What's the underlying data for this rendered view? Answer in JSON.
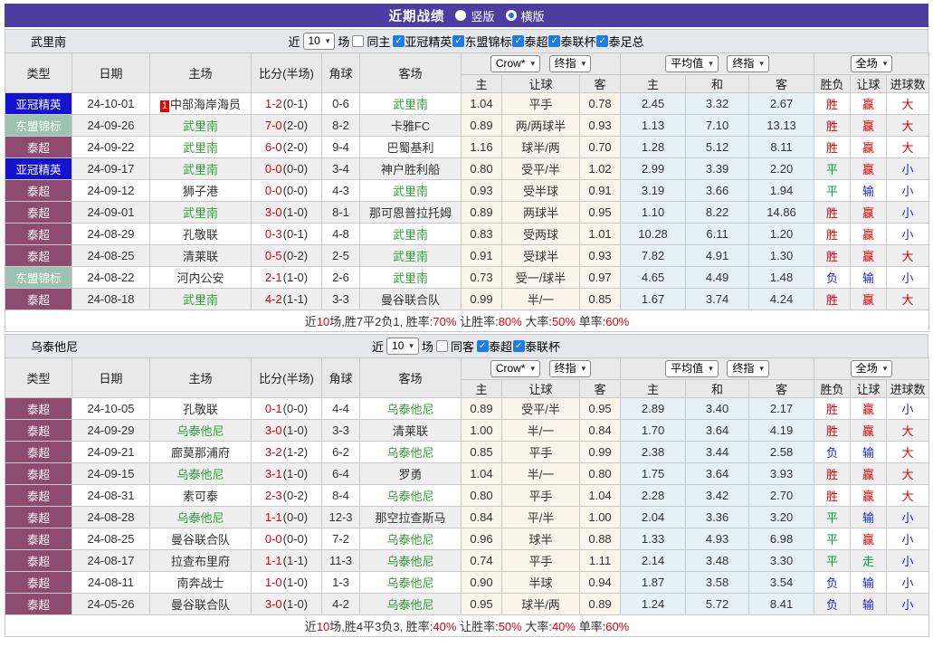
{
  "ui": {
    "title": "近期战绩",
    "radio_vertical": "竖版",
    "radio_horizontal": "横版",
    "recent_label": "近",
    "games_label": "场",
    "selects": {
      "crow": "Crow*",
      "final": "终指",
      "avg": "平均值",
      "full": "全场"
    }
  },
  "columns": {
    "type": "类型",
    "date": "日期",
    "home": "主场",
    "score": "比分(半场)",
    "corner": "角球",
    "away": "客场",
    "odds_home": "主",
    "odds_handicap": "让球",
    "odds_away": "客",
    "avg_home": "主",
    "avg_draw": "和",
    "avg_away": "客",
    "result": "胜负",
    "handicap_result": "让球",
    "goals": "进球数"
  },
  "type_colors": {
    "亚冠精英": "#1212cf",
    "东盟锦标": "#9cc3b2",
    "泰超": "#8c4b6f"
  },
  "colors": {
    "accent_purple": "#4e3da0",
    "red": "#e60000",
    "green": "#00a33e",
    "blue": "#2323cf",
    "team_green": "#2fa136",
    "checkbox_blue": "#1e7ce8"
  },
  "sections": [
    {
      "team": "武里南",
      "filter": {
        "recent": "10",
        "same_label": "同主",
        "same_checked": false,
        "leagues": [
          "亚冠精英",
          "东盟锦标",
          "泰超",
          "泰联杯",
          "泰足总"
        ]
      },
      "rows": [
        {
          "type": "亚冠精英",
          "date": "24-10-01",
          "home": "中部海岸海员",
          "home_hl": false,
          "home_badge": "1",
          "ft": "1-2",
          "ht": "(0-1)",
          "corner": "0-6",
          "away": "武里南",
          "away_hl": true,
          "o1": "1.04",
          "hcp": "平手",
          "o2": "0.78",
          "a1": "2.45",
          "a2": "3.32",
          "a3": "2.67",
          "res": {
            "t": "胜",
            "c": "r"
          },
          "rh": {
            "t": "赢",
            "c": "r"
          },
          "rg": {
            "t": "大",
            "c": "r"
          }
        },
        {
          "type": "东盟锦标",
          "date": "24-09-26",
          "home": "武里南",
          "home_hl": true,
          "ft": "7-0",
          "ht": "(2-0)",
          "corner": "8-2",
          "away": "卡雅FC",
          "away_hl": false,
          "o1": "0.89",
          "hcp": "两/两球半",
          "o2": "0.93",
          "a1": "1.13",
          "a2": "7.10",
          "a3": "13.13",
          "res": {
            "t": "胜",
            "c": "r"
          },
          "rh": {
            "t": "赢",
            "c": "r"
          },
          "rg": {
            "t": "大",
            "c": "r"
          }
        },
        {
          "type": "泰超",
          "date": "24-09-22",
          "home": "武里南",
          "home_hl": true,
          "ft": "6-0",
          "ht": "(2-0)",
          "corner": "9-4",
          "away": "巴蜀基利",
          "away_hl": false,
          "o1": "1.16",
          "hcp": "球半/两",
          "o2": "0.70",
          "a1": "1.28",
          "a2": "5.12",
          "a3": "8.11",
          "res": {
            "t": "胜",
            "c": "r"
          },
          "rh": {
            "t": "赢",
            "c": "r"
          },
          "rg": {
            "t": "大",
            "c": "r"
          }
        },
        {
          "type": "亚冠精英",
          "date": "24-09-17",
          "home": "武里南",
          "home_hl": true,
          "ft": "0-0",
          "ht": "(0-0)",
          "corner": "3-4",
          "away": "神户胜利船",
          "away_hl": false,
          "o1": "0.80",
          "hcp": "受平/半",
          "o2": "1.02",
          "a1": "2.99",
          "a2": "3.39",
          "a3": "2.20",
          "res": {
            "t": "平",
            "c": "g"
          },
          "rh": {
            "t": "赢",
            "c": "r"
          },
          "rg": {
            "t": "小",
            "c": "b"
          }
        },
        {
          "type": "泰超",
          "date": "24-09-12",
          "home": "狮子港",
          "home_hl": false,
          "ft": "0-0",
          "ht": "(0-0)",
          "corner": "4-3",
          "away": "武里南",
          "away_hl": true,
          "o1": "0.93",
          "hcp": "受半球",
          "o2": "0.91",
          "a1": "3.19",
          "a2": "3.66",
          "a3": "1.94",
          "res": {
            "t": "平",
            "c": "g"
          },
          "rh": {
            "t": "输",
            "c": "b"
          },
          "rg": {
            "t": "小",
            "c": "b"
          }
        },
        {
          "type": "泰超",
          "date": "24-09-01",
          "home": "武里南",
          "home_hl": true,
          "ft": "3-0",
          "ht": "(1-0)",
          "corner": "8-1",
          "away": "那可恩普拉托姆",
          "away_hl": false,
          "o1": "0.89",
          "hcp": "两球半",
          "o2": "0.95",
          "a1": "1.10",
          "a2": "8.22",
          "a3": "14.86",
          "res": {
            "t": "胜",
            "c": "r"
          },
          "rh": {
            "t": "赢",
            "c": "r"
          },
          "rg": {
            "t": "小",
            "c": "b"
          }
        },
        {
          "type": "泰超",
          "date": "24-08-29",
          "home": "孔敬联",
          "home_hl": false,
          "ft": "0-3",
          "ht": "(0-1)",
          "corner": "4-8",
          "away": "武里南",
          "away_hl": true,
          "o1": "0.83",
          "hcp": "受两球",
          "o2": "1.01",
          "a1": "10.28",
          "a2": "6.11",
          "a3": "1.20",
          "res": {
            "t": "胜",
            "c": "r"
          },
          "rh": {
            "t": "赢",
            "c": "r"
          },
          "rg": {
            "t": "小",
            "c": "b"
          }
        },
        {
          "type": "泰超",
          "date": "24-08-25",
          "home": "清莱联",
          "home_hl": false,
          "ft": "0-5",
          "ht": "(0-2)",
          "corner": "2-5",
          "away": "武里南",
          "away_hl": true,
          "o1": "0.91",
          "hcp": "受球半",
          "o2": "0.93",
          "a1": "7.82",
          "a2": "4.91",
          "a3": "1.30",
          "res": {
            "t": "胜",
            "c": "r"
          },
          "rh": {
            "t": "赢",
            "c": "r"
          },
          "rg": {
            "t": "大",
            "c": "r"
          }
        },
        {
          "type": "东盟锦标",
          "date": "24-08-22",
          "home": "河内公安",
          "home_hl": false,
          "ft": "2-1",
          "ht": "(1-0)",
          "corner": "2-6",
          "away": "武里南",
          "away_hl": true,
          "o1": "0.73",
          "hcp": "受一/球半",
          "o2": "0.97",
          "a1": "4.65",
          "a2": "4.49",
          "a3": "1.48",
          "res": {
            "t": "负",
            "c": "b"
          },
          "rh": {
            "t": "输",
            "c": "b"
          },
          "rg": {
            "t": "小",
            "c": "b"
          }
        },
        {
          "type": "泰超",
          "date": "24-08-18",
          "home": "武里南",
          "home_hl": true,
          "ft": "4-2",
          "ht": "(1-1)",
          "corner": "3-3",
          "away": "曼谷联合队",
          "away_hl": false,
          "o1": "0.99",
          "hcp": "半/一",
          "o2": "0.85",
          "a1": "1.67",
          "a2": "3.74",
          "a3": "4.24",
          "res": {
            "t": "胜",
            "c": "r"
          },
          "rh": {
            "t": "赢",
            "c": "r"
          },
          "rg": {
            "t": "大",
            "c": "r"
          }
        }
      ],
      "summary": [
        {
          "t": "近"
        },
        {
          "t": "10",
          "r": true
        },
        {
          "t": "场,胜7平2负1, 胜率:"
        },
        {
          "t": "70%",
          "r": true
        },
        {
          "t": " 让胜率:"
        },
        {
          "t": "80%",
          "r": true
        },
        {
          "t": " 大率:"
        },
        {
          "t": "50%",
          "r": true
        },
        {
          "t": " 单率:"
        },
        {
          "t": "60%",
          "r": true
        }
      ]
    },
    {
      "team": "乌泰他尼",
      "filter": {
        "recent": "10",
        "same_label": "同客",
        "same_checked": false,
        "leagues": [
          "泰超",
          "泰联杯"
        ]
      },
      "rows": [
        {
          "type": "泰超",
          "date": "24-10-05",
          "home": "孔敬联",
          "home_hl": false,
          "ft": "0-1",
          "ht": "(0-0)",
          "corner": "4-4",
          "away": "乌泰他尼",
          "away_hl": true,
          "o1": "0.89",
          "hcp": "受平/半",
          "o2": "0.95",
          "a1": "2.89",
          "a2": "3.40",
          "a3": "2.17",
          "res": {
            "t": "胜",
            "c": "r"
          },
          "rh": {
            "t": "赢",
            "c": "r"
          },
          "rg": {
            "t": "小",
            "c": "b"
          }
        },
        {
          "type": "泰超",
          "date": "24-09-29",
          "home": "乌泰他尼",
          "home_hl": true,
          "ft": "3-0",
          "ht": "(1-0)",
          "corner": "3-3",
          "away": "清莱联",
          "away_hl": false,
          "o1": "1.00",
          "hcp": "半/一",
          "o2": "0.84",
          "a1": "1.70",
          "a2": "3.64",
          "a3": "4.19",
          "res": {
            "t": "胜",
            "c": "r"
          },
          "rh": {
            "t": "赢",
            "c": "r"
          },
          "rg": {
            "t": "大",
            "c": "r"
          }
        },
        {
          "type": "泰超",
          "date": "24-09-21",
          "home": "廊莫那浦府",
          "home_hl": false,
          "ft": "3-2",
          "ht": "(1-2)",
          "corner": "6-2",
          "away": "乌泰他尼",
          "away_hl": true,
          "o1": "0.85",
          "hcp": "平手",
          "o2": "0.99",
          "a1": "2.38",
          "a2": "3.44",
          "a3": "2.58",
          "res": {
            "t": "负",
            "c": "b"
          },
          "rh": {
            "t": "输",
            "c": "b"
          },
          "rg": {
            "t": "大",
            "c": "r"
          }
        },
        {
          "type": "泰超",
          "date": "24-09-15",
          "home": "乌泰他尼",
          "home_hl": true,
          "ft": "3-1",
          "ht": "(1-0)",
          "corner": "6-4",
          "away": "罗勇",
          "away_hl": false,
          "o1": "1.04",
          "hcp": "半/一",
          "o2": "0.80",
          "a1": "1.75",
          "a2": "3.64",
          "a3": "3.93",
          "res": {
            "t": "胜",
            "c": "r"
          },
          "rh": {
            "t": "赢",
            "c": "r"
          },
          "rg": {
            "t": "大",
            "c": "r"
          }
        },
        {
          "type": "泰超",
          "date": "24-08-31",
          "home": "素可泰",
          "home_hl": false,
          "ft": "2-3",
          "ht": "(0-2)",
          "corner": "8-4",
          "away": "乌泰他尼",
          "away_hl": true,
          "o1": "0.80",
          "hcp": "平手",
          "o2": "1.04",
          "a1": "2.28",
          "a2": "3.42",
          "a3": "2.70",
          "res": {
            "t": "胜",
            "c": "r"
          },
          "rh": {
            "t": "赢",
            "c": "r"
          },
          "rg": {
            "t": "大",
            "c": "r"
          }
        },
        {
          "type": "泰超",
          "date": "24-08-28",
          "home": "乌泰他尼",
          "home_hl": true,
          "ft": "1-1",
          "ht": "(0-0)",
          "corner": "12-3",
          "away": "那空拉查斯马",
          "away_hl": false,
          "o1": "0.84",
          "hcp": "平/半",
          "o2": "1.00",
          "a1": "2.04",
          "a2": "3.36",
          "a3": "3.20",
          "res": {
            "t": "平",
            "c": "g"
          },
          "rh": {
            "t": "输",
            "c": "b"
          },
          "rg": {
            "t": "小",
            "c": "b"
          }
        },
        {
          "type": "泰超",
          "date": "24-08-25",
          "home": "曼谷联合队",
          "home_hl": false,
          "ft": "0-0",
          "ht": "(0-0)",
          "corner": "7-2",
          "away": "乌泰他尼",
          "away_hl": true,
          "o1": "0.96",
          "hcp": "球半",
          "o2": "0.88",
          "a1": "1.33",
          "a2": "4.93",
          "a3": "6.98",
          "res": {
            "t": "平",
            "c": "g"
          },
          "rh": {
            "t": "赢",
            "c": "r"
          },
          "rg": {
            "t": "小",
            "c": "b"
          }
        },
        {
          "type": "泰超",
          "date": "24-08-17",
          "home": "拉查布里府",
          "home_hl": false,
          "ft": "1-1",
          "ht": "(1-1)",
          "corner": "11-3",
          "away": "乌泰他尼",
          "away_hl": true,
          "o1": "0.74",
          "hcp": "平手",
          "o2": "1.11",
          "a1": "2.14",
          "a2": "3.48",
          "a3": "3.30",
          "res": {
            "t": "平",
            "c": "g"
          },
          "rh": {
            "t": "走",
            "c": "g"
          },
          "rg": {
            "t": "小",
            "c": "b"
          }
        },
        {
          "type": "泰超",
          "date": "24-08-11",
          "home": "南奔战士",
          "home_hl": false,
          "ft": "1-0",
          "ht": "(1-0)",
          "corner": "1-3",
          "away": "乌泰他尼",
          "away_hl": true,
          "o1": "0.90",
          "hcp": "半球",
          "o2": "0.94",
          "a1": "1.87",
          "a2": "3.58",
          "a3": "3.54",
          "res": {
            "t": "负",
            "c": "b"
          },
          "rh": {
            "t": "输",
            "c": "b"
          },
          "rg": {
            "t": "小",
            "c": "b"
          }
        },
        {
          "type": "泰超",
          "date": "24-05-26",
          "home": "曼谷联合队",
          "home_hl": false,
          "ft": "3-0",
          "ht": "(1-0)",
          "corner": "4-2",
          "away": "乌泰他尼",
          "away_hl": true,
          "o1": "0.95",
          "hcp": "球半/两",
          "o2": "0.89",
          "a1": "1.24",
          "a2": "5.72",
          "a3": "8.41",
          "res": {
            "t": "负",
            "c": "b"
          },
          "rh": {
            "t": "输",
            "c": "b"
          },
          "rg": {
            "t": "小",
            "c": "b"
          }
        }
      ],
      "summary": [
        {
          "t": "近"
        },
        {
          "t": "10",
          "r": true
        },
        {
          "t": "场,胜4平3负3, 胜率:"
        },
        {
          "t": "40%",
          "r": true
        },
        {
          "t": " 让胜率:"
        },
        {
          "t": "50%",
          "r": true
        },
        {
          "t": " 大率:"
        },
        {
          "t": "40%",
          "r": true
        },
        {
          "t": " 单率:"
        },
        {
          "t": "60%",
          "r": true
        }
      ]
    }
  ]
}
